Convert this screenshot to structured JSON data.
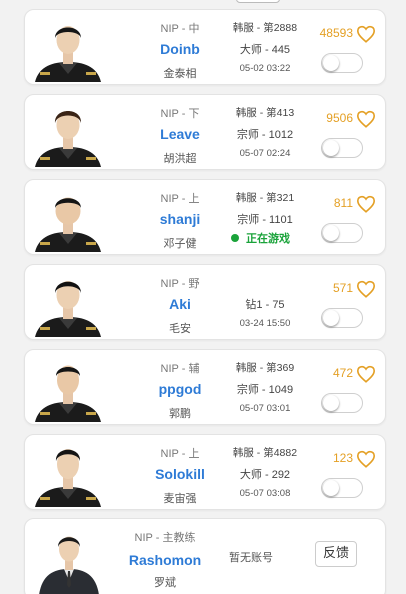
{
  "accent_blue": "#2e7bd6",
  "accent_orange": "#e4a025",
  "status_green": "#1aa33a",
  "players": [
    {
      "team_role": "NIP - 中",
      "name": "Doinb",
      "real_name": "金泰相",
      "server_rank": "韩服 - 第2888",
      "tier": "大师 - 445",
      "time": "05-02 03:22",
      "follow_count": "48593",
      "playing": false
    },
    {
      "team_role": "NIP - 下",
      "name": "Leave",
      "real_name": "胡洪超",
      "server_rank": "韩服 - 第413",
      "tier": "宗师 - 1012",
      "time": "05-07 02:24",
      "follow_count": "9506",
      "playing": false
    },
    {
      "team_role": "NIP - 上",
      "name": "shanji",
      "real_name": "邓子健",
      "server_rank": "韩服 - 第321",
      "tier": "宗师 - 1101",
      "status": "正在游戏",
      "follow_count": "811",
      "playing": true
    },
    {
      "team_role": "NIP - 野",
      "name": "Aki",
      "real_name": "毛安",
      "server_rank": "",
      "tier": "钻1 - 75",
      "time": "03-24 15:50",
      "follow_count": "571",
      "playing": false
    },
    {
      "team_role": "NIP - 辅",
      "name": "ppgod",
      "real_name": "郭鹏",
      "server_rank": "韩服 - 第369",
      "tier": "宗师 - 1049",
      "time": "05-07 03:01",
      "follow_count": "472",
      "playing": false
    },
    {
      "team_role": "NIP - 上",
      "name": "Solokill",
      "real_name": "麦宙强",
      "server_rank": "韩服 - 第4882",
      "tier": "大师 - 292",
      "time": "05-07 03:08",
      "follow_count": "123",
      "playing": false
    }
  ],
  "coach": {
    "team_role": "NIP - 主教练",
    "name": "Rashomon",
    "real_name": "罗斌",
    "account": "暂无账号",
    "feedback_label": "反馈"
  }
}
